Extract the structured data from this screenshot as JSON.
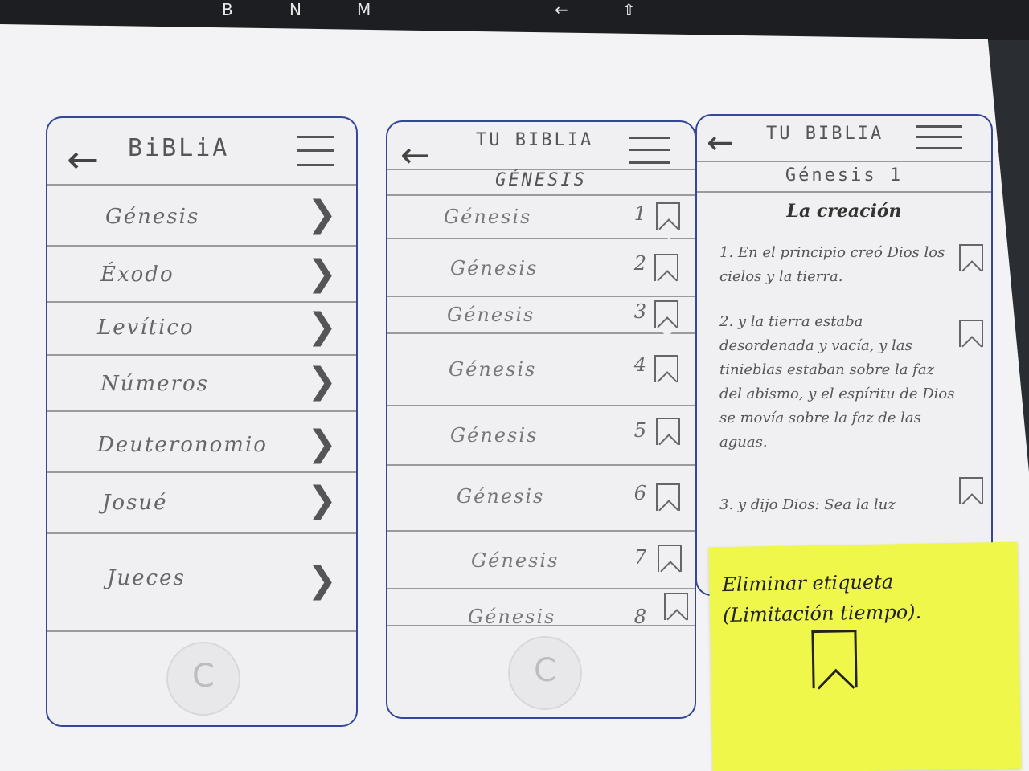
{
  "keyboard": {
    "keys": [
      "B",
      "N",
      "M",
      "←",
      "⇧"
    ]
  },
  "screen1": {
    "title": "BiBLiA",
    "books": [
      "Génesis",
      "Éxodo",
      "Levítico",
      "Números",
      "Deuteronomio",
      "Josué",
      "Jueces"
    ],
    "chevron": "❯"
  },
  "screen2": {
    "title": "TU BIBLIA",
    "subheader": "GÉNESIS",
    "chapters": [
      {
        "label": "Génesis",
        "num": "1"
      },
      {
        "label": "Génesis",
        "num": "2"
      },
      {
        "label": "Génesis",
        "num": "3"
      },
      {
        "label": "Génesis",
        "num": "4"
      },
      {
        "label": "Génesis",
        "num": "5"
      },
      {
        "label": "Génesis",
        "num": "6"
      },
      {
        "label": "Génesis",
        "num": "7"
      },
      {
        "label": "Génesis",
        "num": "8"
      }
    ]
  },
  "screen3": {
    "title": "TU BIBLIA",
    "chapter": "Génesis 1",
    "section": "La creación",
    "verses": [
      "1. En el principio creó Dios los cielos y la tierra.",
      "2. y la tierra estaba desordenada y vacía, y las tinieblas estaban sobre la faz del abismo, y el espíritu de Dios se movía sobre la faz de las aguas.",
      "3. y dijo Dios: Sea la luz"
    ]
  },
  "sticky_note": {
    "text": "Eliminar etiqueta (Limitación tiempo)."
  }
}
